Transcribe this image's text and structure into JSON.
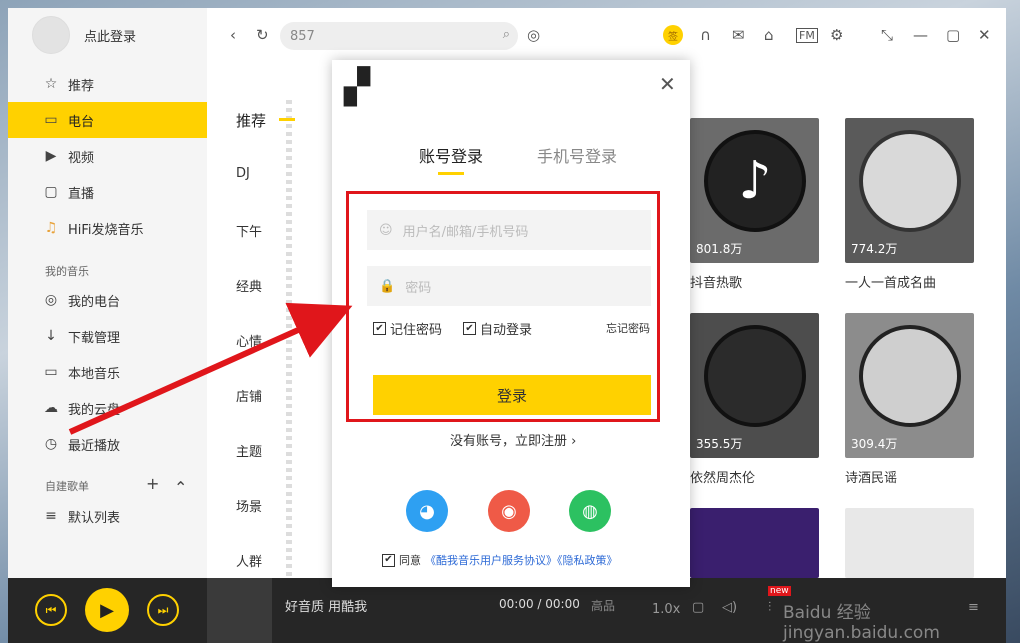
{
  "sidebar": {
    "login_text": "点此登录",
    "items": [
      {
        "label": "推荐",
        "icon": "☆"
      },
      {
        "label": "电台",
        "icon": "▭"
      },
      {
        "label": "视频",
        "icon": "▶"
      },
      {
        "label": "直播",
        "icon": "▢"
      },
      {
        "label": "HiFi发烧音乐",
        "icon": "♫"
      }
    ],
    "my_music_title": "我的音乐",
    "my_items": [
      {
        "label": "我的电台",
        "icon": "◎"
      },
      {
        "label": "下载管理",
        "icon": "↓"
      },
      {
        "label": "本地音乐",
        "icon": "▭"
      },
      {
        "label": "我的云盘",
        "icon": "☁"
      },
      {
        "label": "最近播放",
        "icon": "◷"
      }
    ],
    "created_title": "自建歌单",
    "add_icon": "+",
    "collapse_icon": "⌃",
    "playlist_default": "默认列表"
  },
  "topbar": {
    "search_value": "857",
    "coin_label": "签"
  },
  "categories": [
    "推荐",
    "DJ",
    "下午",
    "经典",
    "心情",
    "店铺",
    "主题",
    "场景",
    "人群"
  ],
  "cards": [
    {
      "play": "801.8万",
      "title": "抖音热歌",
      "bg": "#6b6b6b"
    },
    {
      "play": "774.2万",
      "title": "一人一首成名曲",
      "bg": "#5a5a5a"
    },
    {
      "play": "355.5万",
      "title": "依然周杰伦",
      "bg": "#4d4d4d"
    },
    {
      "play": "309.4万",
      "title": "诗酒民谣",
      "bg": "#8c8c8c"
    }
  ],
  "player": {
    "song": "好音质 用酷我",
    "time": "00:00 / 00:00",
    "quality": "高品",
    "speed": "1.0x",
    "new_badge": "new"
  },
  "dialog": {
    "tab_account": "账号登录",
    "tab_phone": "手机号登录",
    "username_placeholder": "用户名/邮箱/手机号码",
    "password_placeholder": "密码",
    "remember": "记住密码",
    "auto_login": "自动登录",
    "forgot": "忘记密码",
    "login_button": "登录",
    "register": "没有账号，立即注册 ›",
    "agree_prefix": "同意",
    "agree_links": "《酷我音乐用户服务协议》《隐私政策》"
  },
  "watermark": "Baidu 经验  jingyan.baidu.com",
  "colors": {
    "accent": "#ffd100",
    "annotation": "#e0161b"
  }
}
